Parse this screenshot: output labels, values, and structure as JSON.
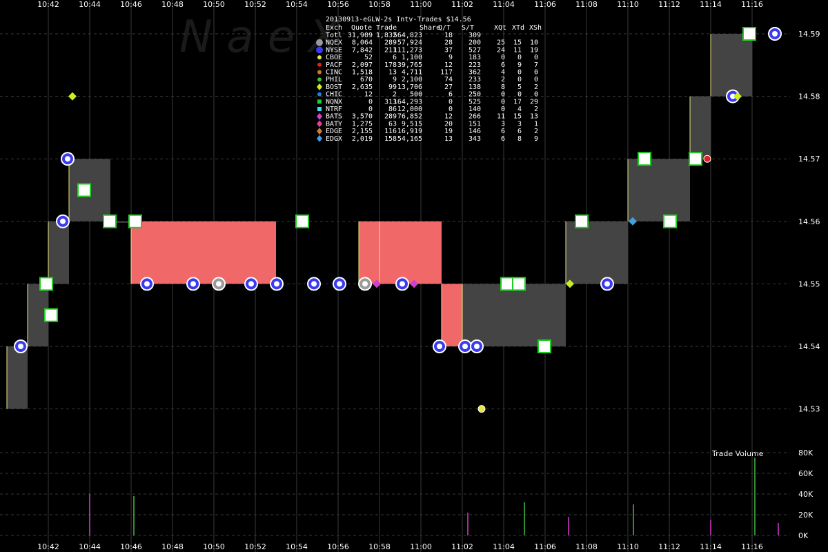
{
  "watermark": "N        a        e        X",
  "chart_data": {
    "type": "scatter",
    "title": "20130913-eGLW-2s Intv-Trades $14.56",
    "x_ticks": [
      "10:42",
      "10:44",
      "10:46",
      "10:48",
      "10:50",
      "10:52",
      "10:54",
      "10:56",
      "10:58",
      "11:00",
      "11:02",
      "11:04",
      "11:06",
      "11:08",
      "11:10",
      "11:12",
      "11:14",
      "11:16"
    ],
    "y_ticks": [
      "14.59",
      "14.58",
      "14.57",
      "14.56",
      "14.55",
      "14.54",
      "14.53"
    ],
    "ylim": [
      14.525,
      14.595
    ],
    "volume_label": "Trade Volume",
    "volume_ticks": [
      "80K",
      "60K",
      "40K",
      "20K",
      "0K"
    ],
    "volume_lim": [
      0,
      80000
    ],
    "legend_header": [
      "Exch",
      "Quote",
      "Trade",
      "Share",
      "Q/T",
      "S/T",
      "XQt",
      "XTd",
      "XSh"
    ],
    "legend_rows": [
      {
        "exch": "Totl",
        "quote": "31,909",
        "trade": "1,832",
        "share": "564,823",
        "qt": "18",
        "st": "309",
        "xqt": "",
        "xtd": "",
        "xsh": "",
        "color": "",
        "marker": "none"
      },
      {
        "exch": "NQEX",
        "quote": "8,064",
        "trade": "289",
        "share": "57,924",
        "qt": "28",
        "st": "200",
        "xqt": "25",
        "xtd": "15",
        "xsh": "10",
        "color": "#9a9a9a",
        "marker": "circle-big"
      },
      {
        "exch": "NYSE",
        "quote": "7,842",
        "trade": "211",
        "share": "111,273",
        "qt": "37",
        "st": "527",
        "xqt": "24",
        "xtd": "11",
        "xsh": "19",
        "color": "#3a3af0",
        "marker": "circle-big"
      },
      {
        "exch": "CBOE",
        "quote": "52",
        "trade": "6",
        "share": "1,100",
        "qt": "9",
        "st": "183",
        "xqt": "0",
        "xtd": "0",
        "xsh": "0",
        "color": "#e6e640",
        "marker": "circle"
      },
      {
        "exch": "PACF",
        "quote": "2,097",
        "trade": "178",
        "share": "39,765",
        "qt": "12",
        "st": "223",
        "xqt": "6",
        "xtd": "9",
        "xsh": "7",
        "color": "#e02020",
        "marker": "circle"
      },
      {
        "exch": "CINC",
        "quote": "1,518",
        "trade": "13",
        "share": "4,711",
        "qt": "117",
        "st": "362",
        "xqt": "4",
        "xtd": "0",
        "xsh": "0",
        "color": "#e07020",
        "marker": "circle"
      },
      {
        "exch": "PHIL",
        "quote": "670",
        "trade": "9",
        "share": "2,100",
        "qt": "74",
        "st": "233",
        "xqt": "2",
        "xtd": "0",
        "xsh": "0",
        "color": "#40c040",
        "marker": "circle"
      },
      {
        "exch": "BOST",
        "quote": "2,635",
        "trade": "99",
        "share": "13,706",
        "qt": "27",
        "st": "138",
        "xqt": "8",
        "xtd": "5",
        "xsh": "2",
        "color": "#c8f020",
        "marker": "diamond"
      },
      {
        "exch": "CHIC",
        "quote": "12",
        "trade": "2",
        "share": "500",
        "qt": "6",
        "st": "250",
        "xqt": "0",
        "xtd": "0",
        "xsh": "0",
        "color": "#2080e0",
        "marker": "circle"
      },
      {
        "exch": "NQNX",
        "quote": "0",
        "trade": "313",
        "share": "164,293",
        "qt": "0",
        "st": "525",
        "xqt": "0",
        "xtd": "17",
        "xsh": "29",
        "color": "#20d020",
        "marker": "square"
      },
      {
        "exch": "NTRF",
        "quote": "0",
        "trade": "86",
        "share": "12,000",
        "qt": "0",
        "st": "140",
        "xqt": "0",
        "xtd": "4",
        "xsh": "2",
        "color": "#40e0e0",
        "marker": "square"
      },
      {
        "exch": "BATS",
        "quote": "3,570",
        "trade": "289",
        "share": "76,852",
        "qt": "12",
        "st": "266",
        "xqt": "11",
        "xtd": "15",
        "xsh": "13",
        "color": "#d040d0",
        "marker": "diamond"
      },
      {
        "exch": "BATY",
        "quote": "1,275",
        "trade": "63",
        "share": "9,515",
        "qt": "20",
        "st": "151",
        "xqt": "3",
        "xtd": "3",
        "xsh": "1",
        "color": "#e040a0",
        "marker": "diamond"
      },
      {
        "exch": "EDGE",
        "quote": "2,155",
        "trade": "116",
        "share": "16,919",
        "qt": "19",
        "st": "146",
        "xqt": "6",
        "xtd": "6",
        "xsh": "2",
        "color": "#d08020",
        "marker": "diamond"
      },
      {
        "exch": "EDGX",
        "quote": "2,019",
        "trade": "158",
        "share": "54,165",
        "qt": "13",
        "st": "343",
        "xqt": "6",
        "xtd": "8",
        "xsh": "9",
        "color": "#40a0e0",
        "marker": "diamond"
      }
    ],
    "nbbo_bands": [
      {
        "t0": "10:40",
        "t1": "10:41",
        "bid": 14.53,
        "ask": 14.54,
        "state": "normal"
      },
      {
        "t0": "10:41",
        "t1": "10:42",
        "bid": 14.54,
        "ask": 14.55,
        "state": "normal"
      },
      {
        "t0": "10:42",
        "t1": "10:43",
        "bid": 14.55,
        "ask": 14.56,
        "state": "normal"
      },
      {
        "t0": "10:43",
        "t1": "10:45",
        "bid": 14.56,
        "ask": 14.57,
        "state": "normal"
      },
      {
        "t0": "10:45",
        "t1": "10:46",
        "bid": 14.56,
        "ask": 14.56,
        "state": "normal"
      },
      {
        "t0": "10:46",
        "t1": "10:53",
        "bid": 14.55,
        "ask": 14.56,
        "state": "locked"
      },
      {
        "t0": "10:57",
        "t1": "10:58",
        "bid": 14.55,
        "ask": 14.56,
        "state": "locked"
      },
      {
        "t0": "10:58",
        "t1": "11:01",
        "bid": 14.55,
        "ask": 14.56,
        "state": "locked"
      },
      {
        "t0": "11:01",
        "t1": "11:02",
        "bid": 14.54,
        "ask": 14.55,
        "state": "locked"
      },
      {
        "t0": "11:02",
        "t1": "11:07",
        "bid": 14.54,
        "ask": 14.55,
        "state": "normal"
      },
      {
        "t0": "11:07",
        "t1": "11:10",
        "bid": 14.55,
        "ask": 14.56,
        "state": "normal"
      },
      {
        "t0": "11:10",
        "t1": "11:13",
        "bid": 14.56,
        "ask": 14.57,
        "state": "normal"
      },
      {
        "t0": "11:13",
        "t1": "11:14",
        "bid": 14.57,
        "ask": 14.58,
        "state": "normal"
      },
      {
        "t0": "11:14",
        "t1": "11:16",
        "bid": 14.58,
        "ask": 14.59,
        "state": "normal"
      }
    ],
    "trades": [
      {
        "t": "10:41",
        "p": 14.54,
        "ex": "NYSE"
      },
      {
        "t": "10:42",
        "p": 14.55,
        "ex": "NQNX"
      },
      {
        "t": "10:42",
        "p": 14.545,
        "ex": "NQNX"
      },
      {
        "t": "10:43",
        "p": 14.56,
        "ex": "NYSE"
      },
      {
        "t": "10:43",
        "p": 14.57,
        "ex": "NYSE"
      },
      {
        "t": "10:43",
        "p": 14.58,
        "ex": "BOST"
      },
      {
        "t": "10:44",
        "p": 14.565,
        "ex": "NQNX"
      },
      {
        "t": "10:45",
        "p": 14.56,
        "ex": "NQNX"
      },
      {
        "t": "10:46",
        "p": 14.56,
        "ex": "NQNX"
      },
      {
        "t": "10:47",
        "p": 14.55,
        "ex": "NYSE"
      },
      {
        "t": "10:49",
        "p": 14.55,
        "ex": "NYSE"
      },
      {
        "t": "10:50",
        "p": 14.55,
        "ex": "NQEX"
      },
      {
        "t": "10:52",
        "p": 14.55,
        "ex": "NYSE"
      },
      {
        "t": "10:53",
        "p": 14.55,
        "ex": "NYSE"
      },
      {
        "t": "10:54",
        "p": 14.56,
        "ex": "NQNX"
      },
      {
        "t": "10:55",
        "p": 14.55,
        "ex": "NYSE"
      },
      {
        "t": "10:56",
        "p": 14.55,
        "ex": "NYSE"
      },
      {
        "t": "10:57",
        "p": 14.55,
        "ex": "NQEX"
      },
      {
        "t": "10:58",
        "p": 14.55,
        "ex": "BATS"
      },
      {
        "t": "10:59",
        "p": 14.55,
        "ex": "NYSE"
      },
      {
        "t": "11:00",
        "p": 14.55,
        "ex": "BATS"
      },
      {
        "t": "11:01",
        "p": 14.54,
        "ex": "NYSE"
      },
      {
        "t": "11:02",
        "p": 14.54,
        "ex": "NYSE"
      },
      {
        "t": "11:03",
        "p": 14.54,
        "ex": "NYSE"
      },
      {
        "t": "11:03",
        "p": 14.53,
        "ex": "CBOE"
      },
      {
        "t": "11:04",
        "p": 14.55,
        "ex": "NQNX"
      },
      {
        "t": "11:05",
        "p": 14.55,
        "ex": "NQNX"
      },
      {
        "t": "11:06",
        "p": 14.54,
        "ex": "NQNX"
      },
      {
        "t": "11:07",
        "p": 14.55,
        "ex": "BOST"
      },
      {
        "t": "11:08",
        "p": 14.56,
        "ex": "NQNX"
      },
      {
        "t": "11:09",
        "p": 14.55,
        "ex": "NYSE"
      },
      {
        "t": "11:10",
        "p": 14.56,
        "ex": "EDGX"
      },
      {
        "t": "11:11",
        "p": 14.57,
        "ex": "NQNX"
      },
      {
        "t": "11:12",
        "p": 14.56,
        "ex": "NQNX"
      },
      {
        "t": "11:13",
        "p": 14.57,
        "ex": "NQNX"
      },
      {
        "t": "11:14",
        "p": 14.57,
        "ex": "PACF"
      },
      {
        "t": "11:15",
        "p": 14.58,
        "ex": "NYSE"
      },
      {
        "t": "11:15",
        "p": 14.58,
        "ex": "BOST"
      },
      {
        "t": "11:16",
        "p": 14.59,
        "ex": "NQNX"
      },
      {
        "t": "11:17",
        "p": 14.59,
        "ex": "NYSE"
      }
    ],
    "volume_bars": [
      {
        "t": "10:44",
        "v": 40000
      },
      {
        "t": "10:46",
        "v": 38000
      },
      {
        "t": "11:02",
        "v": 22000
      },
      {
        "t": "11:05",
        "v": 32000
      },
      {
        "t": "11:07",
        "v": 18000
      },
      {
        "t": "11:10",
        "v": 30000
      },
      {
        "t": "11:14",
        "v": 15000
      },
      {
        "t": "11:16",
        "v": 75000
      },
      {
        "t": "11:17",
        "v": 12000
      }
    ]
  }
}
